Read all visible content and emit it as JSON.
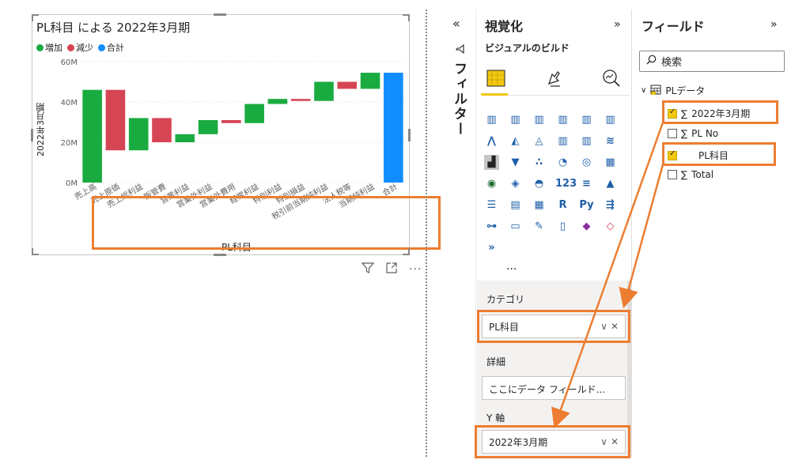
{
  "visual": {
    "title": "PL科目 による 2022年3月期",
    "legend": [
      {
        "label": "増加",
        "color": "#1aab40"
      },
      {
        "label": "減少",
        "color": "#d64554"
      },
      {
        "label": "合計",
        "color": "#118dff"
      }
    ],
    "x_axis_title": "PL科目",
    "y_axis_title": "2022年3月期",
    "tools": {
      "filter_icon": "filter-icon",
      "focus_icon": "focus-mode-icon",
      "more_icon": "more-options-icon"
    }
  },
  "chart_data": {
    "type": "waterfall",
    "categories": [
      "売上高",
      "売上原価",
      "売上総利益",
      "販管費",
      "営業利益",
      "営業外利益",
      "営業外費用",
      "経常利益",
      "特別利益",
      "特別損益",
      "税引前当期純利益",
      "法人税等",
      "当期純利益",
      "合計"
    ],
    "bars": [
      {
        "start": 0,
        "end": 46,
        "kind": "増加"
      },
      {
        "start": 46,
        "end": 16,
        "kind": "減少"
      },
      {
        "start": 16,
        "end": 32,
        "kind": "増加"
      },
      {
        "start": 32,
        "end": 20,
        "kind": "減少"
      },
      {
        "start": 20,
        "end": 24,
        "kind": "増加"
      },
      {
        "start": 24,
        "end": 31,
        "kind": "増加"
      },
      {
        "start": 31,
        "end": 29.5,
        "kind": "減少"
      },
      {
        "start": 29.5,
        "end": 39,
        "kind": "増加"
      },
      {
        "start": 39,
        "end": 41.5,
        "kind": "増加"
      },
      {
        "start": 41.5,
        "end": 40.5,
        "kind": "減少"
      },
      {
        "start": 40.5,
        "end": 50,
        "kind": "増加"
      },
      {
        "start": 50,
        "end": 46.5,
        "kind": "減少"
      },
      {
        "start": 46.5,
        "end": 54.5,
        "kind": "増加"
      },
      {
        "start": 0,
        "end": 54.5,
        "kind": "合計"
      }
    ],
    "y_ticks": [
      "0M",
      "20M",
      "40M",
      "60M"
    ],
    "y_tick_values": [
      0,
      20,
      40,
      60
    ],
    "ylim": [
      0,
      60
    ],
    "grid": true,
    "legend_position": "top-left",
    "xlabel": "PL科目",
    "ylabel": "2022年3月期"
  },
  "filters": {
    "label": "フィルター",
    "collapse_icon": "«"
  },
  "viz": {
    "title": "視覚化",
    "expand_icon": "»",
    "build_label": "ビジュアルのビルド",
    "more": "···",
    "wells": {
      "category_label": "カテゴリ",
      "category_value": "PL科目",
      "details_label": "詳細",
      "details_placeholder": "ここにデータ フィールド...",
      "y_label": "Y 軸",
      "y_value": "2022年3月期",
      "chevron": "∨",
      "remove": "✕"
    }
  },
  "fields": {
    "title": "フィールド",
    "expand_icon": "»",
    "search_placeholder": "検索",
    "table": "PLデータ",
    "sigma": "∑",
    "items": [
      {
        "label": "2022年3月期",
        "checked": true,
        "sigma": true
      },
      {
        "label": "PL No",
        "checked": false,
        "sigma": true
      },
      {
        "label": "PL科目",
        "checked": true,
        "sigma": false
      },
      {
        "label": "Total",
        "checked": false,
        "sigma": true
      }
    ]
  }
}
